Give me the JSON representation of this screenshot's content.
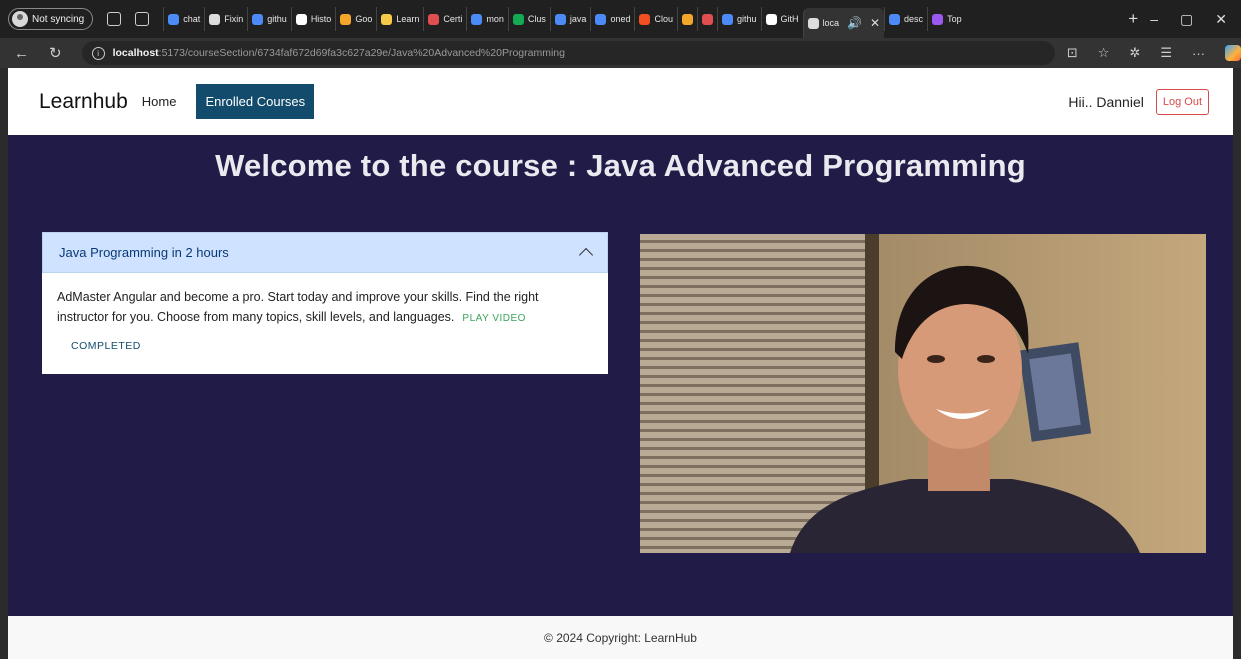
{
  "browser": {
    "profile_label": "Not syncing",
    "tabs": [
      {
        "label": "chat",
        "color": "#4c8bf5"
      },
      {
        "label": "Fixin",
        "color": "#dddddd"
      },
      {
        "label": "githu",
        "color": "#4c8bf5"
      },
      {
        "label": "Histo",
        "color": "#ffffff"
      },
      {
        "label": "Goo",
        "color": "#f4a62a"
      },
      {
        "label": "Learn",
        "color": "#f7c948"
      },
      {
        "label": "Certi",
        "color": "#e04f4f"
      },
      {
        "label": "mon",
        "color": "#4c8bf5"
      },
      {
        "label": "Clus",
        "color": "#13aa52"
      },
      {
        "label": "java",
        "color": "#4c8bf5"
      },
      {
        "label": "oned",
        "color": "#4c8bf5"
      },
      {
        "label": "Clou",
        "color": "#f25022"
      },
      {
        "label": "",
        "color": "#f4a62a"
      },
      {
        "label": "",
        "color": "#e04f4f"
      },
      {
        "label": "githu",
        "color": "#4c8bf5"
      },
      {
        "label": "GitH",
        "color": "#ffffff"
      },
      {
        "label": "loca",
        "color": "#dddddd",
        "active": true
      },
      {
        "label": "desc",
        "color": "#4c8bf5"
      },
      {
        "label": "Top",
        "color": "#9b59f0"
      }
    ],
    "url_host": "localhost",
    "url_path": ":5173/courseSection/6734faf672d69fa3c627a29e/Java%20Advanced%20Programming"
  },
  "navbar": {
    "brand": "Learnhub",
    "home_label": "Home",
    "enrolled_label": "Enrolled Courses",
    "greeting": "Hii.. Danniel",
    "logout_label": "Log Out"
  },
  "course": {
    "welcome": "Welcome to the course : Java Advanced Programming",
    "section_title": "Java Programming in 2 hours",
    "description": "AdMaster Angular and become a pro. Start today and improve your skills. Find the right instructor for you. Choose from many topics, skill levels, and languages.",
    "play_label": "PLAY VIDEO",
    "completed_label": "COMPLETED"
  },
  "footer": {
    "copyright": "© 2024 Copyright: LearnHub"
  }
}
